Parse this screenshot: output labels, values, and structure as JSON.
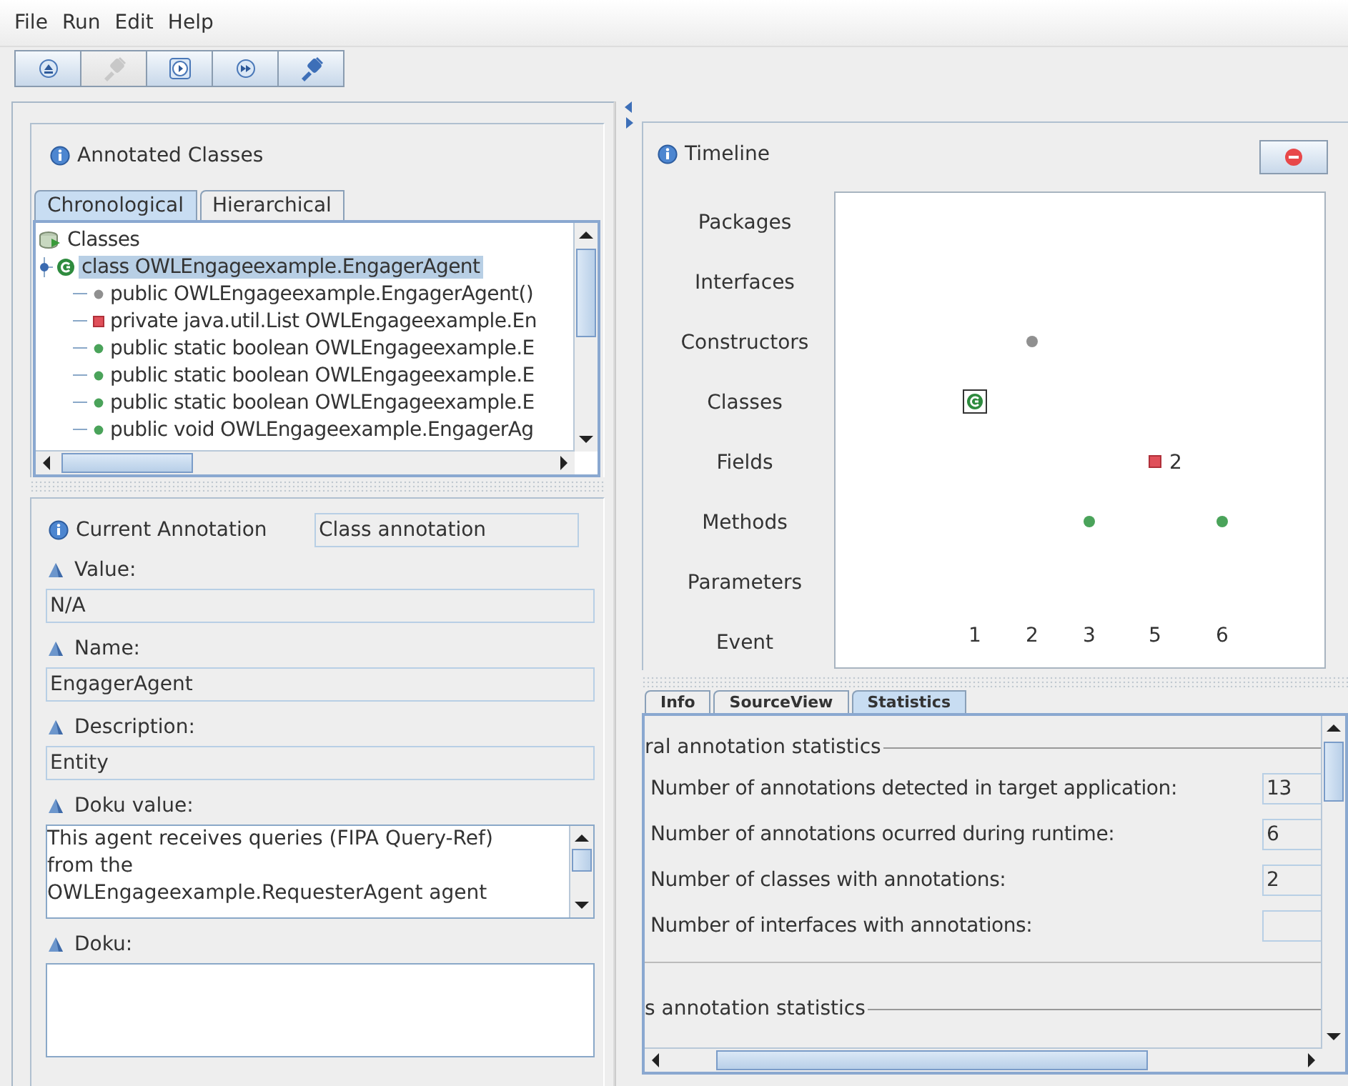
{
  "menu": [
    "File",
    "Run",
    "Edit",
    "Help"
  ],
  "toolbar": [
    {
      "kind": "eject",
      "disabled": false
    },
    {
      "kind": "plug",
      "disabled": true
    },
    {
      "kind": "play",
      "disabled": false
    },
    {
      "kind": "fast-forward",
      "disabled": false
    },
    {
      "kind": "plug",
      "disabled": false
    }
  ],
  "annotated_classes": {
    "title": "Annotated Classes",
    "tabs": [
      {
        "label": "Chronological",
        "selected": true
      },
      {
        "label": "Hierarchical",
        "selected": false
      }
    ],
    "tree": {
      "label": "Classes",
      "children": [
        {
          "label": "class OWLEngageexample.EngagerAgent",
          "selected": true,
          "expanded": true,
          "children": [
            {
              "label": "public OWLEngageexample.EngagerAgent()",
              "kind": "constructor"
            },
            {
              "label": "private java.util.List OWLEngageexample.En",
              "kind": "field"
            },
            {
              "label": "public static boolean OWLEngageexample.E",
              "kind": "method"
            },
            {
              "label": "public static boolean OWLEngageexample.E",
              "kind": "method"
            },
            {
              "label": "public static boolean OWLEngageexample.E",
              "kind": "method"
            },
            {
              "label": "public void OWLEngageexample.EngagerAg",
              "kind": "method"
            }
          ]
        }
      ]
    }
  },
  "current_annotation": {
    "title": "Current Annotation",
    "type": "Class annotation",
    "fields": [
      {
        "label": "Value:",
        "kind": "line",
        "value": "N/A"
      },
      {
        "label": "Name:",
        "kind": "line",
        "value": "EngagerAgent"
      },
      {
        "label": "Description:",
        "kind": "line",
        "value": "Entity"
      },
      {
        "label": "Doku value:",
        "kind": "area",
        "lines": [
          "This agent receives queries (FIPA Query-Ref)",
          "from the",
          "OWLEngageexample.RequesterAgent agent"
        ]
      },
      {
        "label": "Doku:",
        "kind": "area"
      }
    ]
  },
  "timeline": {
    "title": "Timeline",
    "rows": [
      {
        "label": "Packages"
      },
      {
        "label": "Interfaces"
      },
      {
        "label": "Constructors",
        "cells": [
          {
            "kind": "empty"
          },
          {
            "kind": "constructor"
          },
          {
            "kind": "empty"
          },
          {
            "kind": "empty"
          },
          {
            "kind": "empty"
          }
        ]
      },
      {
        "label": "Classes",
        "cells": [
          {
            "kind": "class"
          },
          {
            "kind": "empty"
          },
          {
            "kind": "empty"
          },
          {
            "kind": "empty"
          },
          {
            "kind": "empty"
          }
        ]
      },
      {
        "label": "Fields",
        "cells": [
          {
            "kind": "empty"
          },
          {
            "kind": "empty"
          },
          {
            "kind": "empty"
          },
          {
            "kind": "field",
            "count": "2"
          },
          {
            "kind": "empty"
          }
        ]
      },
      {
        "label": "Methods",
        "cells": [
          {
            "kind": "empty"
          },
          {
            "kind": "empty"
          },
          {
            "kind": "method"
          },
          {
            "kind": "empty"
          },
          {
            "kind": "method"
          }
        ]
      },
      {
        "label": "Parameters"
      }
    ],
    "event_row": {
      "label": "Event",
      "columns": [
        "1",
        "2",
        "3",
        "5",
        "6"
      ]
    }
  },
  "bottom_tabs": [
    {
      "label": "Info",
      "selected": false
    },
    {
      "label": "SourceView",
      "selected": false
    },
    {
      "label": "Statistics",
      "selected": true
    }
  ],
  "statistics": {
    "section_title": "ral annotation statistics",
    "rows": [
      {
        "label": "Number of annotations detected in target application:",
        "value": "13"
      },
      {
        "label": "Number of annotations ocurred during runtime:",
        "value": "6"
      },
      {
        "label": "Number of classes with annotations:",
        "value": "2"
      },
      {
        "label": "Number of interfaces with annotations:"
      }
    ],
    "next_section_title": "s annotation statistics"
  }
}
